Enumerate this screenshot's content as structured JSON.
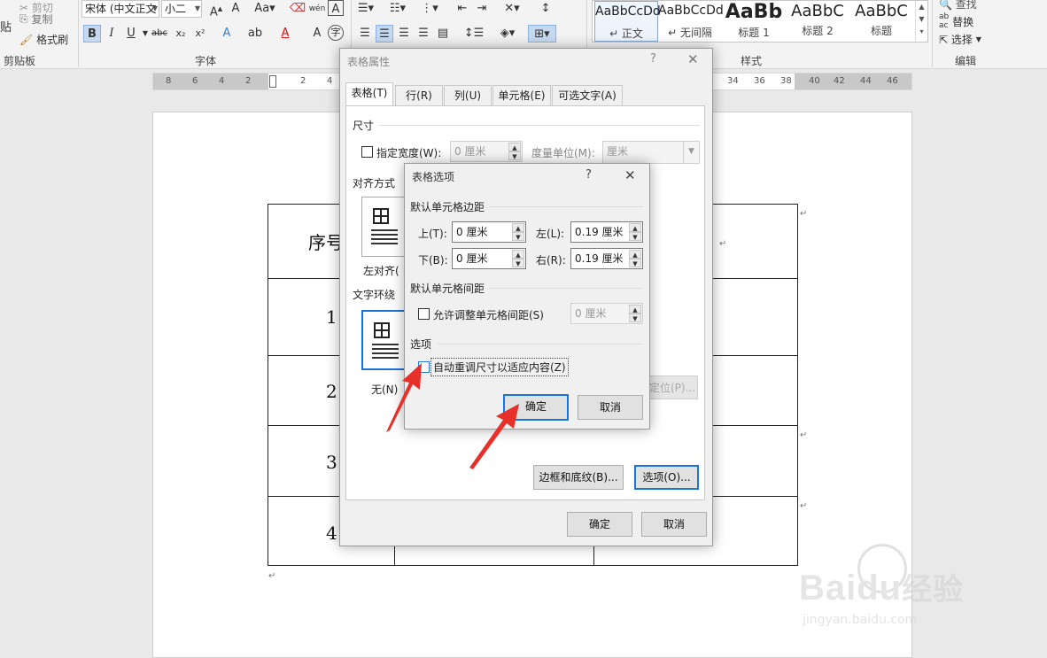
{
  "ribbon": {
    "clipboard": {
      "cut": "剪切",
      "copy": "复制",
      "format_painter": "格式刷",
      "paste": "贴",
      "group_label": "剪贴板"
    },
    "font": {
      "font_name": "宋体 (中文正文",
      "font_size": "小二",
      "group_label": "字体"
    },
    "styles": {
      "group_label": "样式",
      "items": [
        {
          "sample": "AaBbCcDd",
          "name": "↵ 正文"
        },
        {
          "sample": "AaBbCcDd",
          "name": "↵ 无间隔"
        },
        {
          "sample": "AaBb",
          "name": "标题 1"
        },
        {
          "sample": "AaBbC",
          "name": "标题 2"
        },
        {
          "sample": "AaBbC",
          "name": "标题"
        }
      ]
    },
    "editing": {
      "find": "查找",
      "replace": "替换",
      "select": "选择",
      "group_label": "编辑"
    }
  },
  "ruler": {
    "left_marks": [
      "8",
      "6",
      "4",
      "2",
      "2",
      "4"
    ],
    "right_marks": [
      "34",
      "36",
      "38",
      "40",
      "42",
      "44",
      "46"
    ]
  },
  "document": {
    "cells": [
      "序号",
      "1",
      "2",
      "3",
      "4"
    ],
    "para_mark": "↵"
  },
  "table_props": {
    "title": "表格属性",
    "help": "?",
    "close": "✕",
    "tabs": [
      "表格(T)",
      "行(R)",
      "列(U)",
      "单元格(E)",
      "可选文字(A)"
    ],
    "size_section": "尺寸",
    "preferred_width_label": "指定宽度(W):",
    "preferred_width_value": "0 厘米",
    "measure_label": "度量单位(M):",
    "measure_value": "厘米",
    "alignment_section": "对齐方式",
    "align_left_label": "左对齐(",
    "wrapping_section": "文字环绕",
    "wrap_none_label": "无(N)",
    "positioning_button": "定位(P)...",
    "borders_button": "边框和底纹(B)...",
    "options_button": "选项(O)...",
    "ok": "确定",
    "cancel": "取消"
  },
  "table_options": {
    "title": "表格选项",
    "help": "?",
    "close": "✕",
    "margins_section": "默认单元格边距",
    "top_label": "上(T):",
    "top_value": "0 厘米",
    "left_label": "左(L):",
    "left_value": "0.19 厘米",
    "bottom_label": "下(B):",
    "bottom_value": "0 厘米",
    "right_label": "右(R):",
    "right_value": "0.19 厘米",
    "spacing_section": "默认单元格间距",
    "allow_spacing_label": "允许调整单元格间距(S)",
    "spacing_value": "0 厘米",
    "options_section": "选项",
    "autoresize_label": "自动重调尺寸以适应内容(Z)",
    "autoresize_checked": false,
    "ok": "确定",
    "cancel": "取消"
  },
  "watermark": {
    "brand": "Bai",
    "brand2": "du",
    "product": "经验",
    "url": "jingyan.baidu.com"
  },
  "colors": {
    "arrow": "#e8302a",
    "focus": "#1a73d9"
  }
}
